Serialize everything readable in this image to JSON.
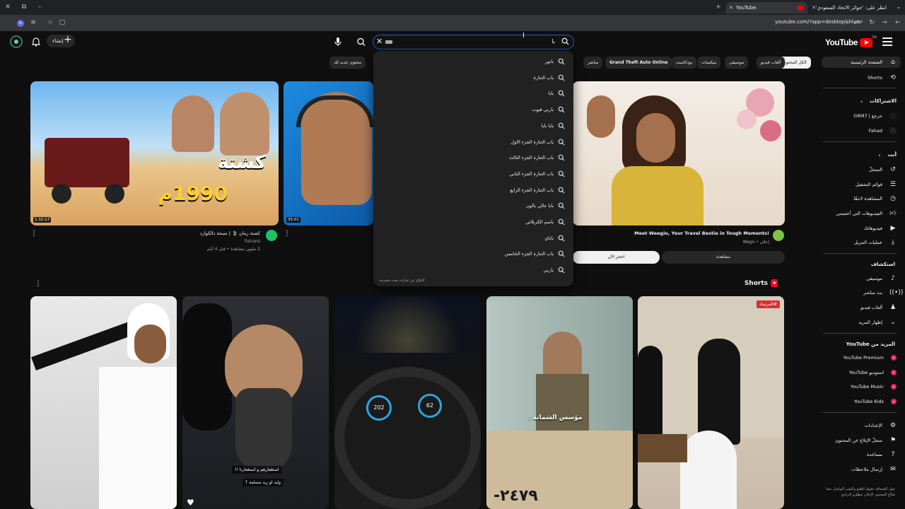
{
  "browser": {
    "tabs": [
      {
        "title": "انظر على: 'جوائز الاتحاد السعودي'",
        "active": false
      },
      {
        "title": "YouTube",
        "active": true
      }
    ],
    "new_tab": "+",
    "url": "youtube.com/?app=desktop&hl=ar"
  },
  "header": {
    "logo_text": "YouTube",
    "logo_region": "SA",
    "search_query": "با",
    "create_label": "إنشاء"
  },
  "chips": [
    "الكل المحتوى",
    "ألعاب فيديو",
    "موسيقى",
    "ميكسات",
    "بودكاست",
    "Grand Theft Auto Online",
    "مباشر",
    "محتوى جديد لك"
  ],
  "suggestions": {
    "items": [
      "بابور",
      "باب الحارة",
      "بابا",
      "باربي قيوب",
      "بابا بابا",
      "باب الحارة الجزء الاول",
      "باب الحارة الجزء الثالث",
      "باب الحارة الجزء الثاني",
      "باب الحارة الجزء الرابع",
      "بابا جالي بالون",
      "باسم الكربلائي",
      "باباي",
      "باب الحارة الجزء الخامس",
      "باربي"
    ],
    "report": "الإبلاغ عن عبارات بحث مقترحة"
  },
  "videos": [
    {
      "title": "كشتة زمان 🍃 | نسخة دالكوارد",
      "thumb_text": "كشتة",
      "thumb_year": "1990م",
      "channel": "Falcons",
      "meta": "2 مليون مشاهدة • قبل 4 أيام",
      "duration": "1:32:17"
    },
    {
      "title": "",
      "duration": "35:01"
    }
  ],
  "ad": {
    "title": "Meet Weegio, Your Travel Bestie in Tough Moments!",
    "meta": "إعلان • Wego",
    "primary": "مشاهدة",
    "secondary": "احجز الآن"
  },
  "shorts": {
    "title": "Shorts",
    "items": [
      {
        "caption": ""
      },
      {
        "caption": "استغفارهم و استغفارنا !!",
        "caption2": "وليد او زيد مسلمة ؟"
      },
      {
        "caption": ""
      },
      {
        "caption": "مؤسس الشماتة :",
        "plate": "٢٤٧٩-"
      },
      {
        "caption": "#المرصاد"
      }
    ]
  },
  "sidebar": {
    "main": [
      {
        "label": "الصفحة الرئيسية",
        "icon": "home-icon",
        "active": true
      },
      {
        "label": "Shorts",
        "icon": "shorts-icon"
      }
    ],
    "subs_header": "الاشتراكات",
    "subs": [
      {
        "label": "جرجع | GRM7"
      },
      {
        "label": "Fahad"
      }
    ],
    "you_header": "أنت",
    "you": [
      {
        "label": "السجلّ",
        "icon": "history-icon"
      },
      {
        "label": "قوائم التشغيل",
        "icon": "playlist-icon"
      },
      {
        "label": "المشاهدة لاحقًا",
        "icon": "clock-icon"
      },
      {
        "label": "الفيديوهات التي أعجبتني",
        "icon": "thumb-up-icon"
      },
      {
        "label": "فيديوهاتك",
        "icon": "video-icon"
      },
      {
        "label": "عمليات التنزيل",
        "icon": "download-icon"
      }
    ],
    "explore_header": "استكشاف",
    "explore": [
      {
        "label": "موسيقى",
        "icon": "music-icon"
      },
      {
        "label": "بث مباشر",
        "icon": "live-icon"
      },
      {
        "label": "ألعاب فيديو",
        "icon": "gaming-icon"
      },
      {
        "label": "إظهار المزيد",
        "icon": "chevron-down-icon"
      }
    ],
    "more_header": "المزيد من YouTube",
    "more": [
      {
        "label": "YouTube Premium"
      },
      {
        "label": "استوديو YouTube"
      },
      {
        "label": "YouTube Music"
      },
      {
        "label": "YouTube Kids"
      }
    ],
    "settings": [
      {
        "label": "الإعدادات",
        "icon": "gear-icon"
      },
      {
        "label": "سجلّ الإبلاغ عن المحتوى",
        "icon": "flag-icon"
      },
      {
        "label": "مساعدة",
        "icon": "help-icon"
      },
      {
        "label": "إرسال ملاحظات",
        "icon": "feedback-icon"
      }
    ],
    "footer": "حول  الصحافة  حقوق الطبع والنشر  التواصل معنا  صنّاع المحتوى  الإعلان  مطوّرو البرامج"
  }
}
